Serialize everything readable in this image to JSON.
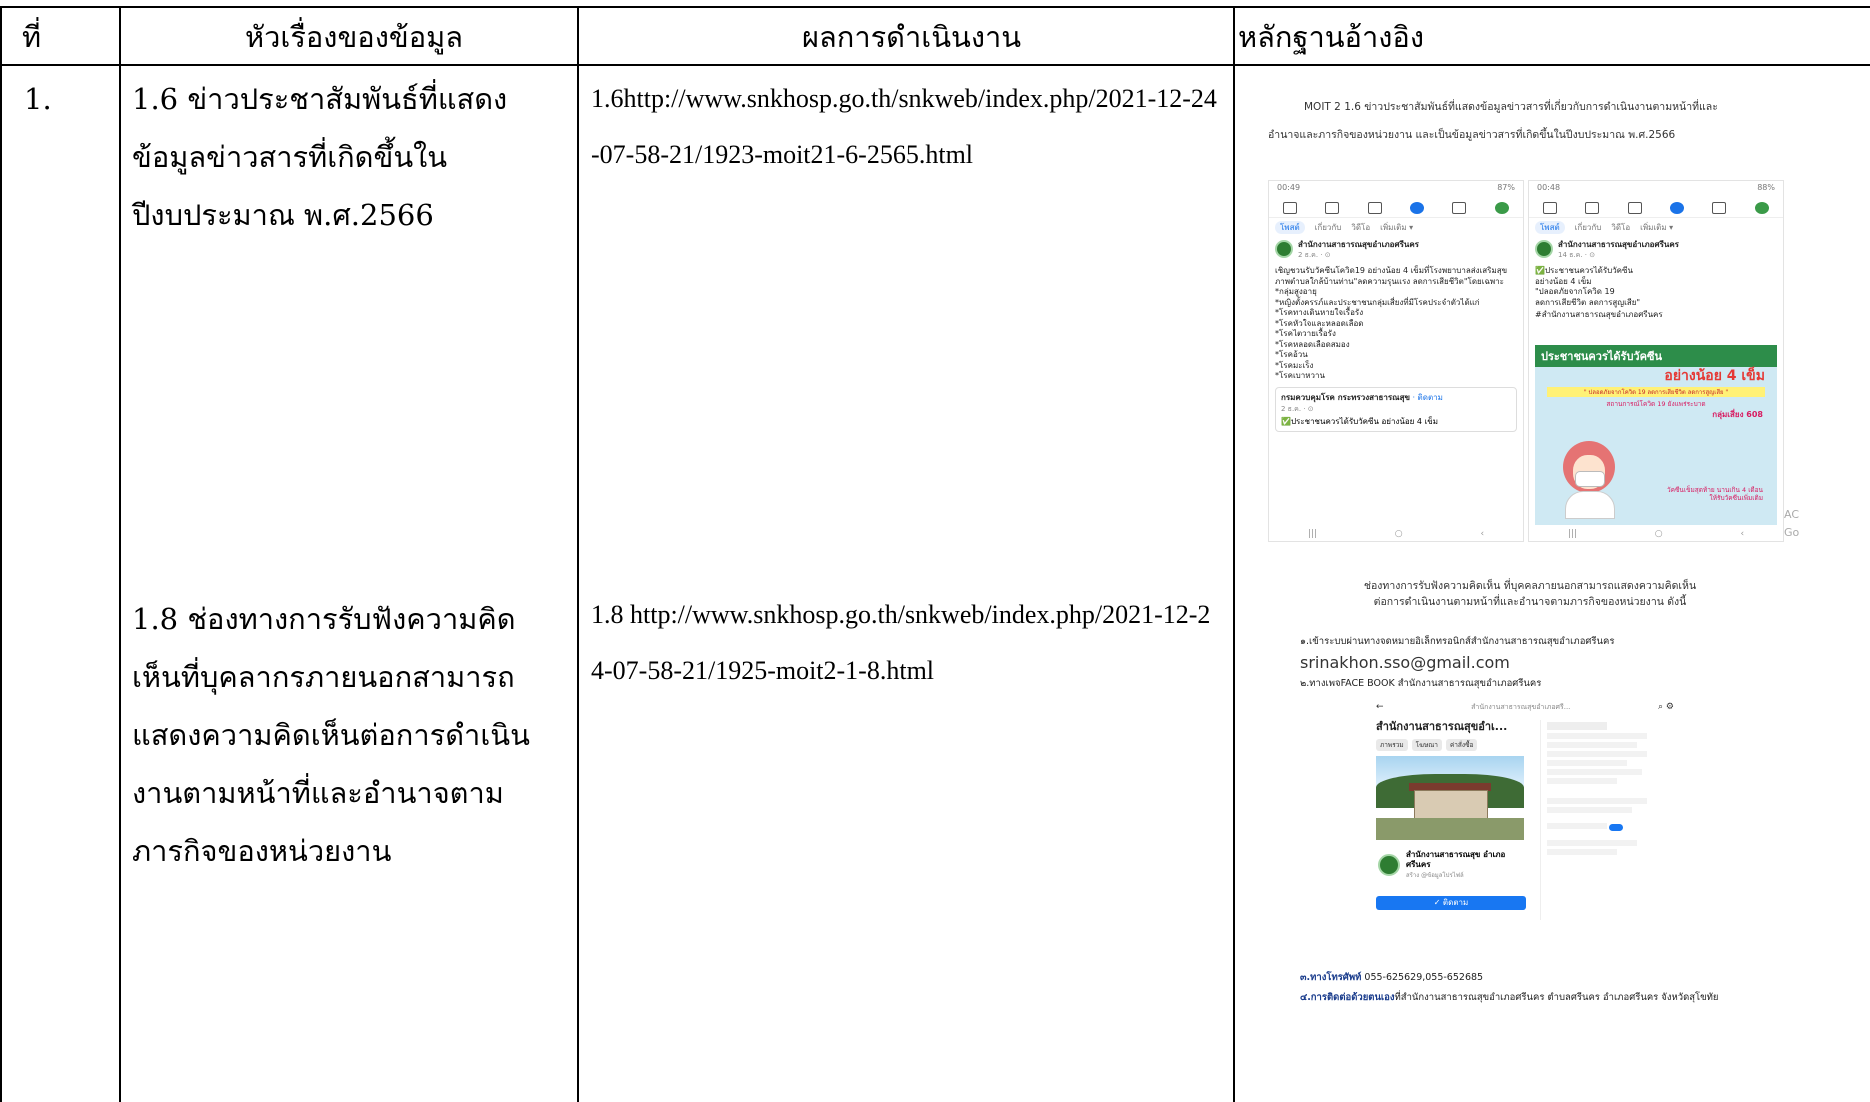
{
  "header": {
    "col_no": "ที่",
    "col_topic": "หัวเรื่องของข้อมูล",
    "col_result": "ผลการดำเนินงาน",
    "col_evidence": "หลักฐานอ้างอิง"
  },
  "row": {
    "no": "1.",
    "topic_1_6": "1.6 ข่าวประชาสัมพันธ์ที่แสดงข้อมูลข่าวสารที่เกิดขึ้นในปีงบประมาณ พ.ศ.2566",
    "result_1_6": "1.6http://www.snkhosp.go.th/snkweb/index.php/2021-12-24-07-58-21/1923-moit21-6-2565.html",
    "topic_1_8": "1.8 ช่องทางการรับฟังความคิดเห็นที่บุคลากรภายนอกสามารถแสดงความคิดเห็นต่อการดำเนินงานตามหน้าที่และอำนาจตามภารกิจของหน่วยงาน",
    "result_1_8": "1.8  http://www.snkhosp.go.th/snkweb/index.php/2021-12-24-07-58-21/1925-moit2-1-8.html"
  },
  "evidence_1_6": {
    "caption_line1": "MOIT 2  1.6  ข่าวประชาสัมพันธ์ที่แสดงข้อมูลข่าวสารที่เกี่ยวกับการดำเนินงานตามหน้าที่และ",
    "caption_line2": "อำนาจและภารกิจของหน่วยงาน และเป็นข้อมูลข่าวสารที่เกิดขึ้นในปีงบประมาณ พ.ศ.2566",
    "phone_left": {
      "time": "00:49",
      "battery": "87%",
      "tab_active": "โพสต์",
      "tab_about": "เกี่ยวกับ",
      "tab_video": "วิดีโอ",
      "tab_more": "เพิ่มเติม ▾",
      "page_name": "สำนักงานสาธารณสุขอำเภอศรีนคร",
      "date": "2 ธ.ค. · ⊙",
      "post_text": "เชิญชวนรับวัคซีนโควิด19 อย่างน้อย 4 เข็มที่โรงพยาบาลส่งเสริมสุขภาพตำบลใกล้บ้านท่าน\"ลดความรุนแรง ลดการเสียชีวิต\"โดยเฉพาะ\n*กลุ่มสูงอายุ\n*หญิงตั้งครรภ์และประชาชนกลุ่มเสี่ยงที่มีโรคประจำตัวได้แก่\n*โรคทางเดินหายใจเรื้อรัง\n*โรคหัวใจและหลอดเลือด\n*โรคไตวายเรื้อรัง\n*โรคหลอดเลือดสมอง\n*โรคอ้วน\n*โรคมะเร็ง\n*โรคเบาหวาน",
      "shared_page": "กรมควบคุมโรค กระทรวงสาธารณสุข",
      "shared_follow": "· ติดตาม",
      "shared_date": "2 ธ.ค. · ⊙",
      "shared_text": "✅ประชาชนควรได้รับวัคซีน อย่างน้อย 4 เข็ม"
    },
    "phone_right": {
      "time": "00:48",
      "battery": "88%",
      "page_name": "สำนักงานสาธารณสุขอำเภอศรีนคร",
      "date": "14 ธ.ค. · ⊙",
      "post_text": "✅ประชาชนควรได้รับวัคซีน\nอย่างน้อย 4 เข็ม\n\"ปลอดภัยจากโควิด 19\nลดการเสียชีวิต ลดการสูญเสีย\"",
      "hashtag": "#สำนักงานสาธารณสุขอำเภอศรีนคร",
      "poster_title": "ประชาชนควรได้รับวัคซีน",
      "poster_big": "อย่างน้อย 4 เข็ม",
      "poster_yellow": "\" ปลอดภัยจากโควิด 19 ลดการเสียชีวิต ลดการสูญเสีย \"",
      "poster_red": "สถานการณ์โควิด 19 ยังแพร่ระบาด",
      "poster_group": "กลุ่มเสี่ยง 608",
      "poster_bottom": "วัคซีนเข็มสุดท้าย นานเกิน 4 เดือน ให้รับวัคซีนเพิ่มเติม"
    },
    "watermark": "AC Go"
  },
  "evidence_1_8": {
    "title_line1": "ช่องทางการรับฟังความคิดเห็น ที่บุคคลภายนอกสามารถแสดงความคิดเห็น",
    "title_line2": "ต่อการดำเนินงานตามหน้าที่และอำนาจตามภารกิจของหน่วยงาน ดังนี้",
    "item1": "๑.เข้าระบบผ่านทางจดหมายอิเล็กทรอนิกส์สำนักงานสาธารณสุขอำเภอศรีนคร",
    "email": "srinakhon.sso@gmail.com",
    "item2": "๒.ทางเพจFACE BOOK สำนักงานสาธารณสุขอำเภอศรีนคร",
    "fb_page_name": "สำนักงานสาธารณสุขอำเ...",
    "fb_btn1": "ภาพรวม",
    "fb_btn2": "โฆษณา",
    "fb_btn3": "ค่าสั่งซื้อ",
    "fb_profile_name": "สำนักงานสาธารณสุข อำเภอศรีนคร",
    "fb_profile_sub": "สร้าง @ข้อมูลโปรไฟล์",
    "fb_follow": "✓ ติดตาม",
    "item3_label": "๓.ทางโทรศัพท์",
    "item3_value": "055-625629,055-652685",
    "item4_label": "๔.การติดต่อด้วยตนเอง",
    "item4_value": "ที่สำนักงานสาธารณสุขอำเภอศรีนคร ตำบลศรีนคร อำเภอศรีนคร จังหวัดสุโขทัย"
  },
  "icons": [
    "home-icon",
    "video-icon",
    "megaphone-icon",
    "profile-icon",
    "notification-icon",
    "search-icon",
    "settings-icon",
    "back-arrow-icon",
    "gear-icon"
  ],
  "colors": {
    "border": "#000000",
    "link_blue": "#1a73e8",
    "fb_blue": "#1877f2",
    "poster_green": "#2d8d4a"
  }
}
